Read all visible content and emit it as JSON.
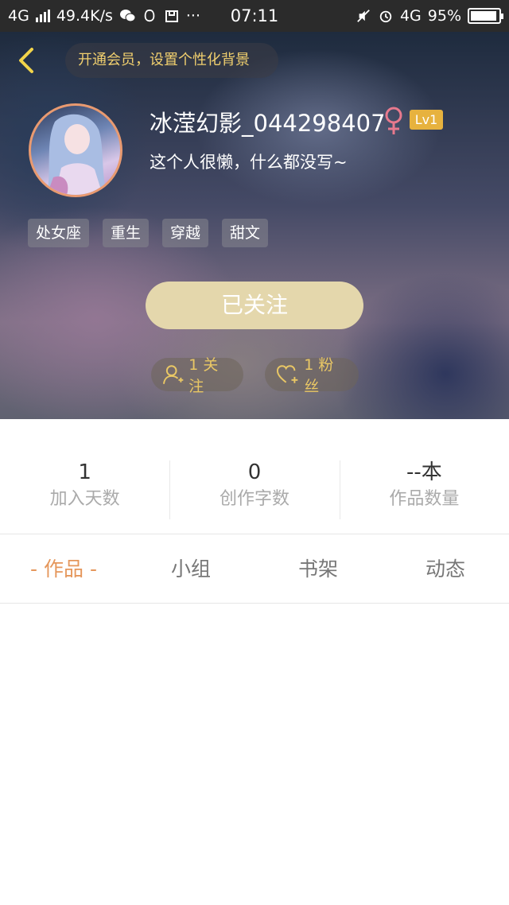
{
  "status_bar": {
    "network": "4G",
    "speed": "49.4K/s",
    "more": "···",
    "time": "07:11",
    "network_right": "4G",
    "battery": "95%",
    "battery_level": 0.95
  },
  "header": {
    "vip_prompt": "开通会员，设置个性化背景",
    "username": "冰滢幻影_044298407",
    "gender_symbol": "♀",
    "level": "Lv1",
    "bio": "这个人很懒，什么都没写~",
    "tags": [
      "处女座",
      "重生",
      "穿越",
      "甜文"
    ],
    "follow_button": "已关注",
    "following_count": "1 关注",
    "fans_count": "1 粉丝"
  },
  "stats": [
    {
      "value": "1",
      "label": "加入天数"
    },
    {
      "value": "0",
      "label": "创作字数"
    },
    {
      "value": "--本",
      "label": "作品数量"
    }
  ],
  "tabs": [
    "- 作品 -",
    "小组",
    "书架",
    "动态"
  ],
  "colors": {
    "accent_orange": "#e5975c",
    "gold": "#e9c765",
    "level_badge": "#e7b23e",
    "follow_button": "#e4d7ac"
  }
}
